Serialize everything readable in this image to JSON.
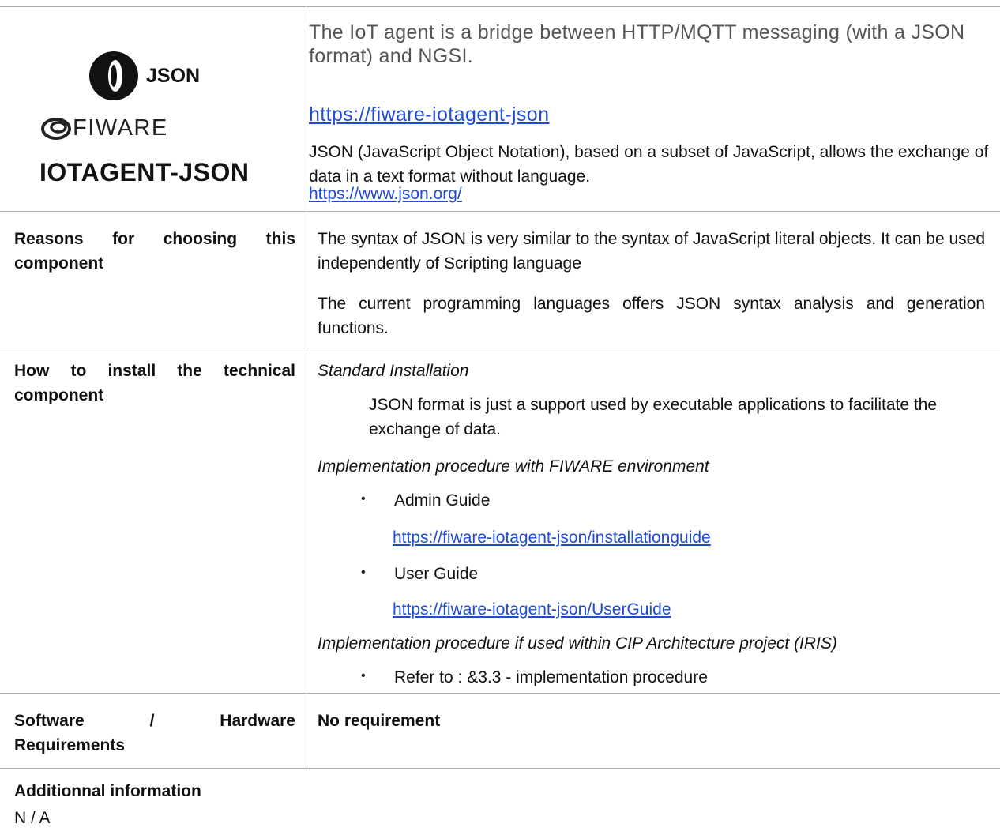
{
  "logo": {
    "json_word": "JSON",
    "fiware_word": "FIWARE",
    "product_name": "IOTAGENT-JSON"
  },
  "intro": {
    "description": "The IoT agent is a bridge between HTTP/MQTT messaging (with a JSON format) and NGSI.",
    "repo_link": "https://fiware-iotagent-json",
    "json_desc": "JSON (JavaScript Object Notation), based on a subset of JavaScript, allows the exchange of data in a text format without language.",
    "json_link": "https://www.json.org/"
  },
  "rows": {
    "reasons": {
      "label": "Reasons for choosing this component",
      "p1": "The syntax of JSON is very similar to the syntax of JavaScript literal objects. It can be used independently of Scripting language",
      "p2": "The current programming languages offers JSON syntax analysis and generation functions."
    },
    "install": {
      "label": "How to install the technical component",
      "standard_heading": "Standard Installation",
      "standard_text": "JSON format is just a support used by executable applications to facilitate the exchange of data.",
      "fiware_heading": "Implementation procedure with FIWARE environment",
      "admin_label": "Admin Guide",
      "admin_link": "https://fiware-iotagent-json/installationguide",
      "user_label": "User Guide",
      "user_link": "https://fiware-iotagent-json/UserGuide",
      "cip_heading": "Implementation procedure if used within CIP Architecture project (IRIS)",
      "cip_ref": "Refer to : &3.3 -  implementation procedure"
    },
    "requirements": {
      "label_part1": "Software",
      "label_sep": "/",
      "label_part2": "Hardware",
      "label_line2": "Requirements",
      "value": "No requirement"
    },
    "additional": {
      "label": "Additionnal information",
      "value": "N / A"
    }
  },
  "colors": {
    "link": "#1f4bd4",
    "border": "#a9a9a9",
    "intro_text": "#555555"
  },
  "bullet_glyph": "•"
}
